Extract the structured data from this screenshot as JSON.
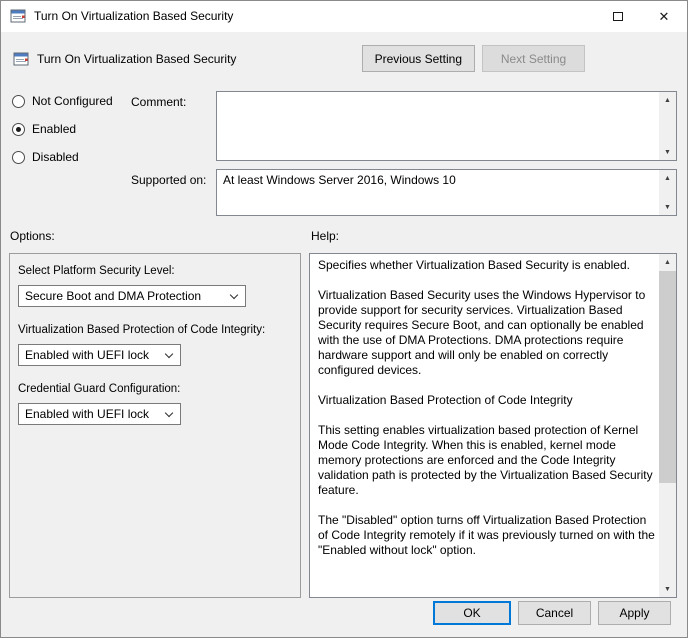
{
  "window": {
    "title": "Turn On Virtualization Based Security"
  },
  "icons": {
    "close": "✕",
    "scroll_up": "▲",
    "scroll_down": "▼"
  },
  "header": {
    "title": "Turn On Virtualization Based Security",
    "previous_label": "Previous Setting",
    "next_label": "Next Setting"
  },
  "state": {
    "radios": [
      {
        "label": "Not Configured",
        "selected": false
      },
      {
        "label": "Enabled",
        "selected": true
      },
      {
        "label": "Disabled",
        "selected": false
      }
    ],
    "comment_label": "Comment:",
    "comment_value": "",
    "supported_label": "Supported on:",
    "supported_value": "At least Windows Server 2016, Windows 10"
  },
  "options": {
    "section_label": "Options:",
    "fields": [
      {
        "label": "Select Platform Security Level:",
        "value": "Secure Boot and DMA Protection"
      },
      {
        "label": "Virtualization Based Protection of Code Integrity:",
        "value": "Enabled with UEFI lock"
      },
      {
        "label": "Credential Guard Configuration:",
        "value": "Enabled with UEFI lock"
      }
    ]
  },
  "help": {
    "section_label": "Help:",
    "paragraphs": [
      "Specifies whether Virtualization Based Security is enabled.",
      "Virtualization Based Security uses the Windows Hypervisor to provide support for security services. Virtualization Based Security requires Secure Boot, and can optionally be enabled with the use of DMA Protections. DMA protections require hardware support and will only be enabled on correctly configured devices.",
      "Virtualization Based Protection of Code Integrity",
      "This setting enables virtualization based protection of Kernel Mode Code Integrity. When this is enabled, kernel mode memory protections are enforced and the Code Integrity validation path is protected by the Virtualization Based Security feature.",
      "The \"Disabled\" option turns off Virtualization Based Protection of Code Integrity remotely if it was previously turned on with the \"Enabled without lock\" option."
    ]
  },
  "footer": {
    "ok_label": "OK",
    "cancel_label": "Cancel",
    "apply_label": "Apply"
  },
  "colors": {
    "accent": "#0078d7",
    "window_bg": "#f0f0f0",
    "titlebar_bg": "#ffffff"
  }
}
